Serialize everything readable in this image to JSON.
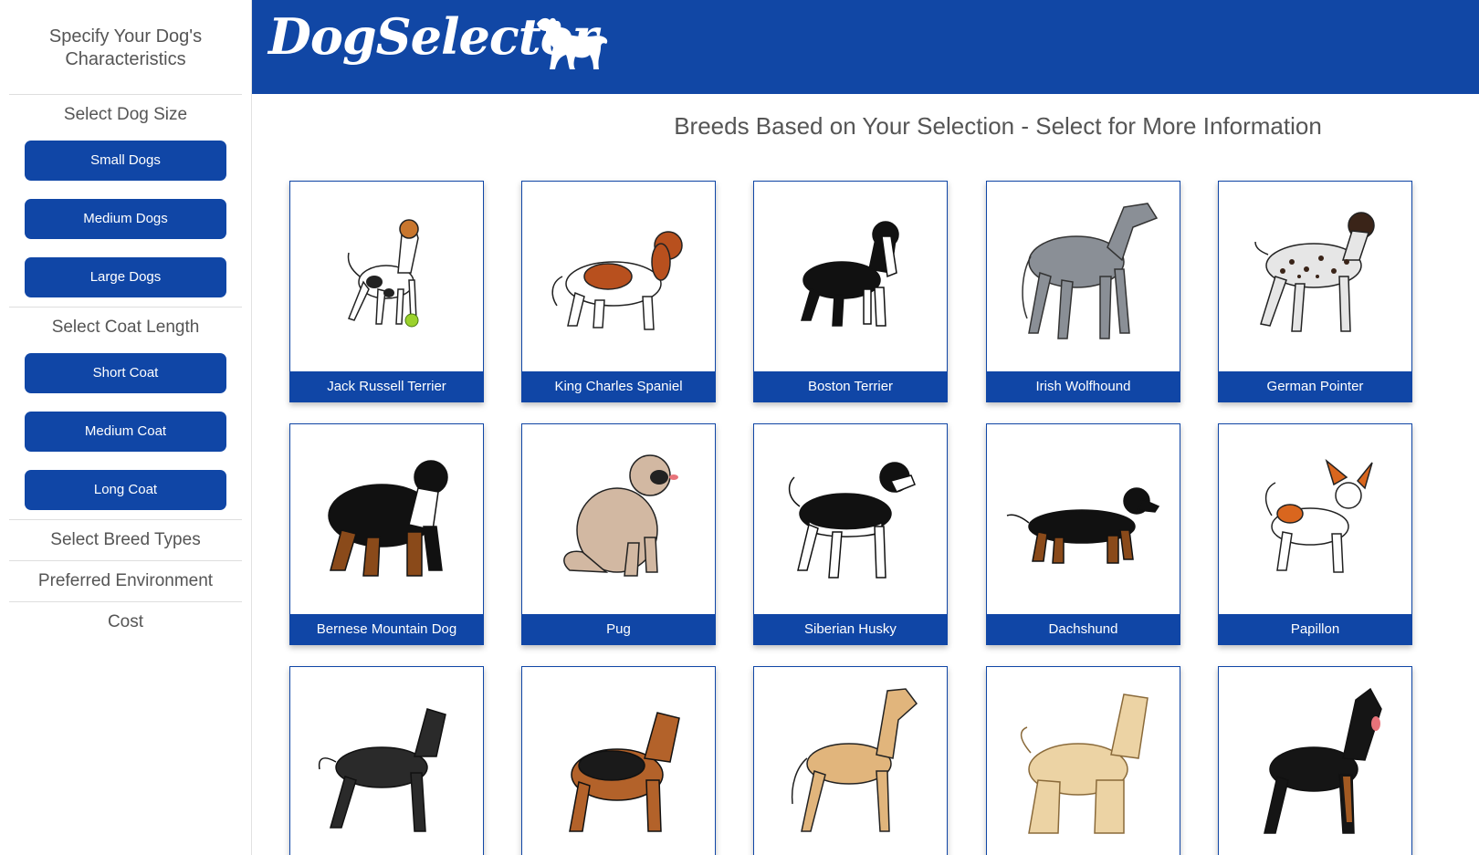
{
  "sidebar": {
    "heading": "Specify Your Dog's Characteristics",
    "size_title": "Select Dog Size",
    "size_options": [
      "Small Dogs",
      "Medium Dogs",
      "Large Dogs"
    ],
    "coat_title": "Select Coat Length",
    "coat_options": [
      "Short Coat",
      "Medium Coat",
      "Long Coat"
    ],
    "breed_types": "Select Breed Types",
    "environment": "Preferred Environment",
    "cost": "Cost"
  },
  "header": {
    "logo_text": "DogSelector",
    "logo_icon": "dog-silhouette-icon"
  },
  "main": {
    "title": "Breeds Based on Your Selection - Select for More Information",
    "breeds": [
      {
        "name": "Jack Russell Terrier"
      },
      {
        "name": "King Charles Spaniel"
      },
      {
        "name": "Boston Terrier"
      },
      {
        "name": "Irish Wolfhound"
      },
      {
        "name": "German Pointer"
      },
      {
        "name": "Bernese Mountain Dog"
      },
      {
        "name": "Pug"
      },
      {
        "name": "Siberian Husky"
      },
      {
        "name": "Dachshund"
      },
      {
        "name": "Papillon"
      }
    ]
  },
  "colors": {
    "brand_blue": "#1046a6",
    "header_blue": "#1147a5"
  }
}
